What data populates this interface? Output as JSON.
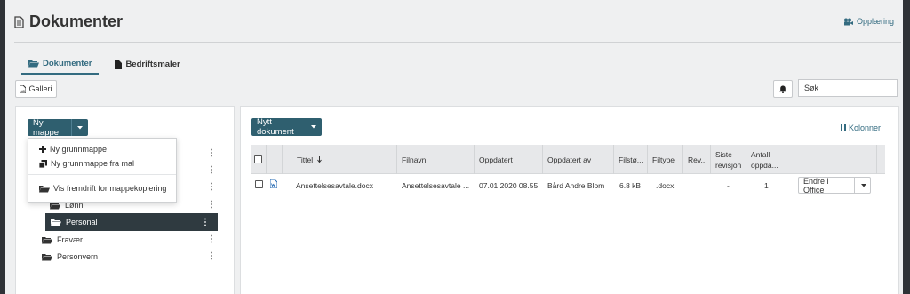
{
  "page": {
    "title": "Dokumenter",
    "training_link": "Opplæring"
  },
  "tabs": [
    {
      "label": "Dokumenter",
      "active": true
    },
    {
      "label": "Bedriftsmaler",
      "active": false
    }
  ],
  "toolbar": {
    "gallery_label": "Galleri",
    "search_placeholder": "Søk"
  },
  "left": {
    "new_folder_label": "Ny mappe",
    "dropdown": [
      {
        "label": "Ny grunnmappe",
        "icon": "plus-icon"
      },
      {
        "label": "Ny grunnmappe fra mal",
        "icon": "copy-icon"
      },
      {
        "label": "Vis fremdrift for mappekopiering",
        "icon": "folder-open-icon"
      }
    ],
    "folders": [
      {
        "label": "Lønn",
        "selected": false
      },
      {
        "label": "Personal",
        "selected": true
      },
      {
        "label": "Fravær",
        "selected": false
      },
      {
        "label": "Personvern",
        "selected": false
      }
    ]
  },
  "right": {
    "new_doc_label": "Nytt dokument",
    "columns_label": "Kolonner",
    "headers": {
      "title": "Tittel",
      "filename": "Filnavn",
      "updated": "Oppdatert",
      "updated_by": "Oppdatert av",
      "filesize": "Filstø...",
      "filetype": "Filtype",
      "rev": "Rev...",
      "last_rev_1": "Siste",
      "last_rev_2": "revisjon",
      "count_1": "Antall",
      "count_2": "oppda..."
    },
    "rows": [
      {
        "title": "Ansettelsesavtale.docx",
        "filename": "Ansettelsesavtale ...",
        "updated": "07.01.2020 08.55",
        "updated_by": "Bård Andre Blom",
        "filesize": "6.8 kB",
        "filetype": ".docx",
        "last_revision": "-",
        "update_count": "1",
        "action_label": "Endre i Office"
      }
    ]
  },
  "colors": {
    "accent": "#336b80",
    "button": "#2f5f6f",
    "selected": "#2f3a40"
  }
}
